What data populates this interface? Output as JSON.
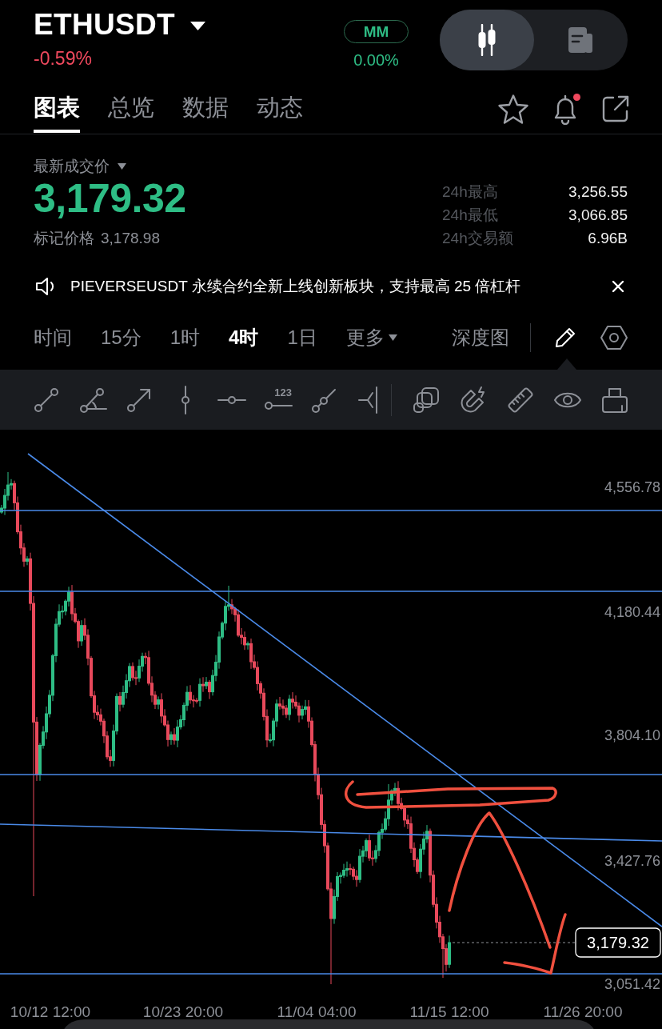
{
  "header": {
    "symbol": "ETHUSDT",
    "change": "-0.59%",
    "falling": true,
    "badge": {
      "label": "MM",
      "value": "0.00%"
    }
  },
  "view_modes": [
    {
      "kind": "chart",
      "selected": true
    },
    {
      "kind": "news",
      "selected": false
    }
  ],
  "tabs": [
    {
      "label": "图表",
      "selected": true
    },
    {
      "label": "总览",
      "selected": false
    },
    {
      "label": "数据",
      "selected": false
    },
    {
      "label": "动态",
      "selected": false
    }
  ],
  "actions": [
    {
      "kind": "favorite"
    },
    {
      "kind": "alerts",
      "unread": true
    },
    {
      "kind": "share"
    }
  ],
  "price": {
    "label": "最新成交价",
    "last": "3,179.32",
    "rising": true,
    "mark_label": "标记价格",
    "mark": "3,178.98"
  },
  "stats": [
    {
      "label": "24h最高",
      "value": "3,256.55"
    },
    {
      "label": "24h最低",
      "value": "3,066.85"
    },
    {
      "label": "24h交易额",
      "value": "6.96B"
    }
  ],
  "announcement": {
    "text": "PIEVERSEUSDT 永续合约全新上线创新板块，支持最高 25 倍杠杆"
  },
  "intervals": [
    {
      "kind": "interval",
      "label": "时间",
      "selected": false
    },
    {
      "kind": "interval",
      "label": "15分",
      "selected": false
    },
    {
      "kind": "interval",
      "label": "1时",
      "selected": false
    },
    {
      "kind": "interval",
      "label": "4时",
      "selected": true
    },
    {
      "kind": "interval",
      "label": "1日",
      "selected": false
    },
    {
      "kind": "menu",
      "label": "更多",
      "selected": false
    }
  ],
  "depth_chart": {
    "label": "深度图"
  },
  "draw_mode": {
    "selected": true
  },
  "drawing_tools": [
    {
      "kind": "segment"
    },
    {
      "kind": "angle"
    },
    {
      "kind": "arrow"
    },
    {
      "kind": "vertical"
    },
    {
      "kind": "horizontal"
    },
    {
      "kind": "number",
      "label": "123"
    },
    {
      "kind": "ray"
    },
    {
      "kind": "fork"
    }
  ],
  "utility_tools": [
    {
      "kind": "layers"
    },
    {
      "kind": "magnet"
    },
    {
      "kind": "ruler"
    },
    {
      "kind": "eye"
    },
    {
      "kind": "case"
    }
  ],
  "chart": {
    "price_axis": [
      "4,556.78",
      "4,180.44",
      "3,804.10",
      "3,427.76",
      "3,051.42"
    ],
    "time_axis": [
      "10/12 12:00",
      "10/23 20:00",
      "11/04 04:00",
      "11/15 12:00",
      "11/26 20:00"
    ],
    "current_price": "3,179.32"
  }
}
